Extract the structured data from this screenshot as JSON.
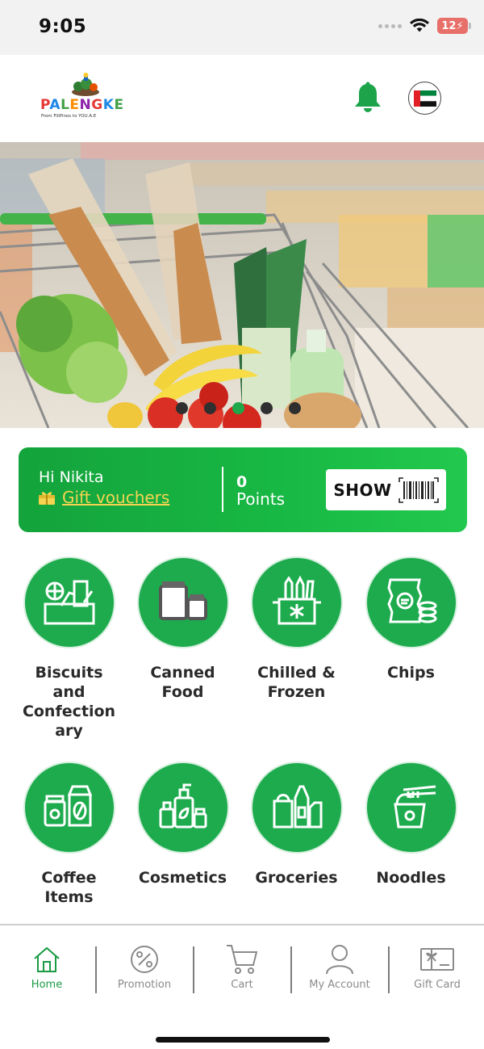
{
  "status_bar": {
    "time": "9:05",
    "battery": "12"
  },
  "header": {
    "logo_text": [
      "P",
      "A",
      "L",
      "E",
      "N",
      "G",
      "K",
      "E"
    ],
    "logo_tagline": "From FiliPinos to YOU.A.E"
  },
  "banner": {
    "slide_count": 5,
    "active_slide": 3
  },
  "loyalty": {
    "greeting": "Hi Nikita",
    "vouchers_label": "Gift vouchers",
    "points_value": "0",
    "points_label": "Points",
    "show_label": "SHOW"
  },
  "categories": [
    {
      "label": "Biscuits and Confection ary",
      "icon": "biscuits-icon"
    },
    {
      "label": "Canned Food",
      "icon": "canned-food-icon"
    },
    {
      "label": "Chilled & Frozen",
      "icon": "chilled-frozen-icon"
    },
    {
      "label": "Chips",
      "icon": "chips-icon"
    },
    {
      "label": "Coffee Items",
      "icon": "coffee-icon"
    },
    {
      "label": "Cosmetics",
      "icon": "cosmetics-icon"
    },
    {
      "label": "Groceries",
      "icon": "groceries-icon"
    },
    {
      "label": "Noodles",
      "icon": "noodles-icon"
    }
  ],
  "bottom_nav": [
    {
      "label": "Home",
      "icon": "home-icon",
      "active": true
    },
    {
      "label": "Promotion",
      "icon": "percent-icon",
      "active": false
    },
    {
      "label": "Cart",
      "icon": "cart-icon",
      "active": false
    },
    {
      "label": "My Account",
      "icon": "user-icon",
      "active": false
    },
    {
      "label": "Gift Card",
      "icon": "gift-card-icon",
      "active": false
    }
  ],
  "colors": {
    "brand_green": "#1dab4d",
    "voucher_yellow": "#f5d451",
    "nav_active": "#1a9b44"
  }
}
